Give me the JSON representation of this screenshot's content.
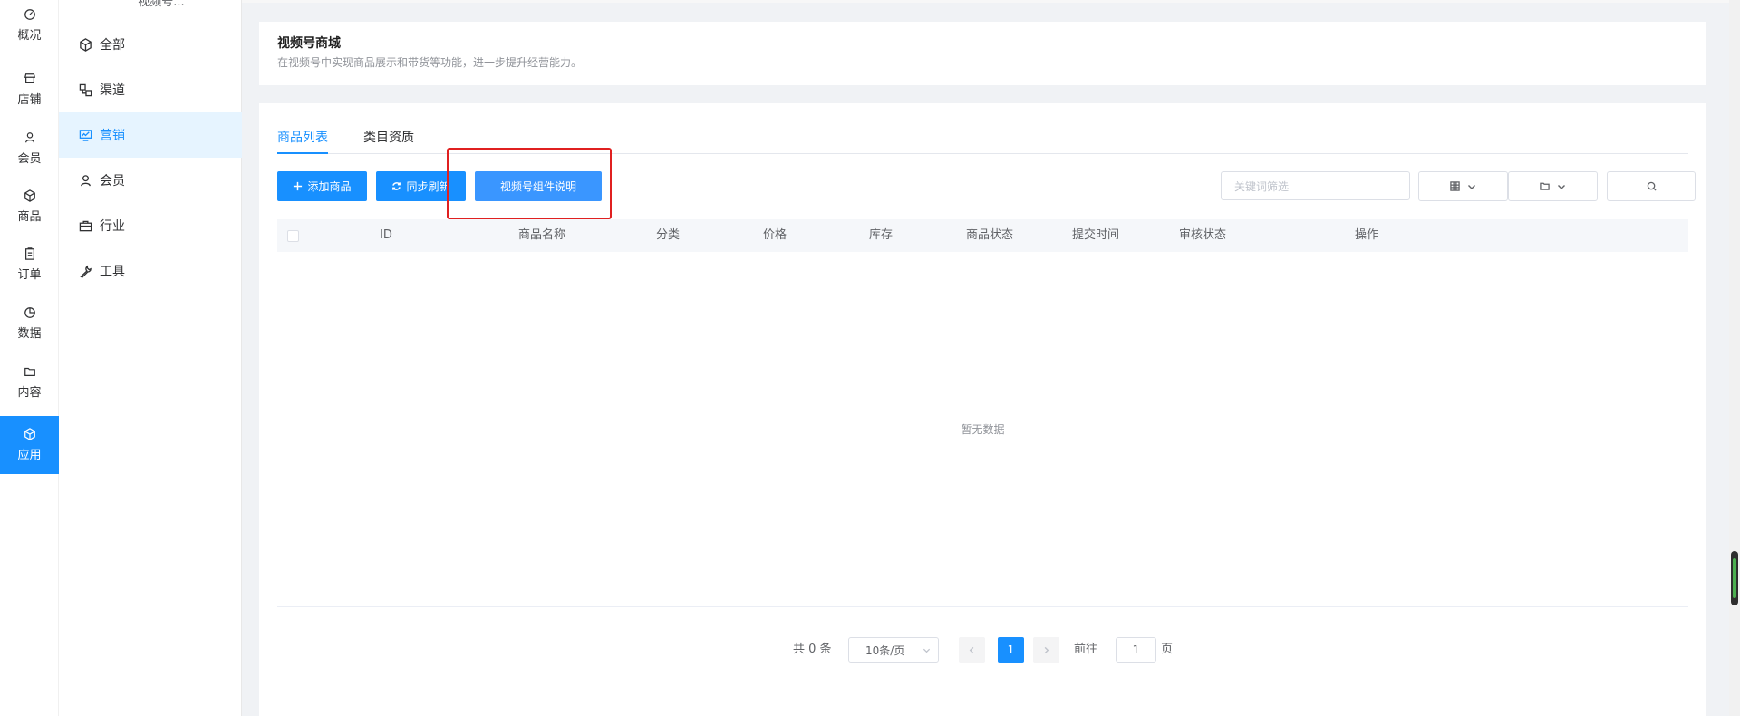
{
  "rail": {
    "items": [
      {
        "label": "概况",
        "icon": "dashboard-icon"
      },
      {
        "label": "店铺",
        "icon": "store-icon"
      },
      {
        "label": "会员",
        "icon": "user-icon"
      },
      {
        "label": "商品",
        "icon": "cube-icon"
      },
      {
        "label": "订单",
        "icon": "clipboard-icon"
      },
      {
        "label": "数据",
        "icon": "pie-chart-icon"
      },
      {
        "label": "内容",
        "icon": "folder-icon"
      },
      {
        "label": "应用",
        "icon": "cube-icon"
      }
    ],
    "active_index": 7
  },
  "submenu": {
    "title": "视频号...",
    "items": [
      {
        "label": "全部",
        "icon": "cube-icon"
      },
      {
        "label": "渠道",
        "icon": "channel-icon"
      },
      {
        "label": "营销",
        "icon": "monitor-chart-icon"
      },
      {
        "label": "会员",
        "icon": "user-icon"
      },
      {
        "label": "行业",
        "icon": "briefcase-icon"
      },
      {
        "label": "工具",
        "icon": "wrench-icon"
      }
    ],
    "active_index": 2
  },
  "intro": {
    "title": "视频号商城",
    "description": "在视频号中实现商品展示和带货等功能，进一步提升经营能力。"
  },
  "tabs": [
    {
      "label": "商品列表",
      "active": true
    },
    {
      "label": "类目资质",
      "active": false
    }
  ],
  "toolbar": {
    "add_label": "添加商品",
    "sync_label": "同步刷新",
    "help_label": "视频号组件说明",
    "search_placeholder": "关键词筛选"
  },
  "table": {
    "columns": [
      "ID",
      "商品名称",
      "分类",
      "价格",
      "库存",
      "商品状态",
      "提交时间",
      "审核状态",
      "操作"
    ],
    "rows": [],
    "empty_text": "暂无数据"
  },
  "pagination": {
    "total_text": "共 0 条",
    "page_size": "10条/页",
    "current_page": "1",
    "goto_label": "前往",
    "goto_value": "1",
    "page_suffix": "页"
  },
  "colors": {
    "primary": "#1890ff",
    "highlight_border": "#e02020"
  }
}
